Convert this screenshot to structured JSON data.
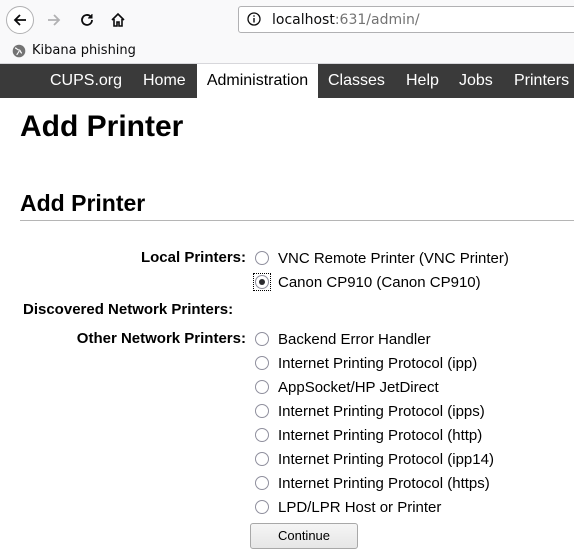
{
  "browser": {
    "url_host": "localhost",
    "url_rest": ":631/admin/",
    "bookmark_label": "Kibana phishing"
  },
  "cups_nav": {
    "tabs": [
      "CUPS.org",
      "Home",
      "Administration",
      "Classes",
      "Help",
      "Jobs",
      "Printers"
    ],
    "active": "Administration"
  },
  "page_title": "Add Printer",
  "section_title": "Add Printer",
  "groups": {
    "local_label": "Local Printers:",
    "discovered_label": "Discovered Network Printers:",
    "other_label": "Other Network Printers:"
  },
  "local_printers": [
    {
      "label": "VNC Remote Printer (VNC Printer)",
      "checked": false
    },
    {
      "label": "Canon CP910 (Canon CP910)",
      "checked": true
    }
  ],
  "other_printers": [
    {
      "label": "Backend Error Handler",
      "checked": false
    },
    {
      "label": "Internet Printing Protocol (ipp)",
      "checked": false
    },
    {
      "label": "AppSocket/HP JetDirect",
      "checked": false
    },
    {
      "label": "Internet Printing Protocol (ipps)",
      "checked": false
    },
    {
      "label": "Internet Printing Protocol (http)",
      "checked": false
    },
    {
      "label": "Internet Printing Protocol (ipp14)",
      "checked": false
    },
    {
      "label": "Internet Printing Protocol (https)",
      "checked": false
    },
    {
      "label": "LPD/LPR Host or Printer",
      "checked": false
    }
  ],
  "continue_label": "Continue"
}
